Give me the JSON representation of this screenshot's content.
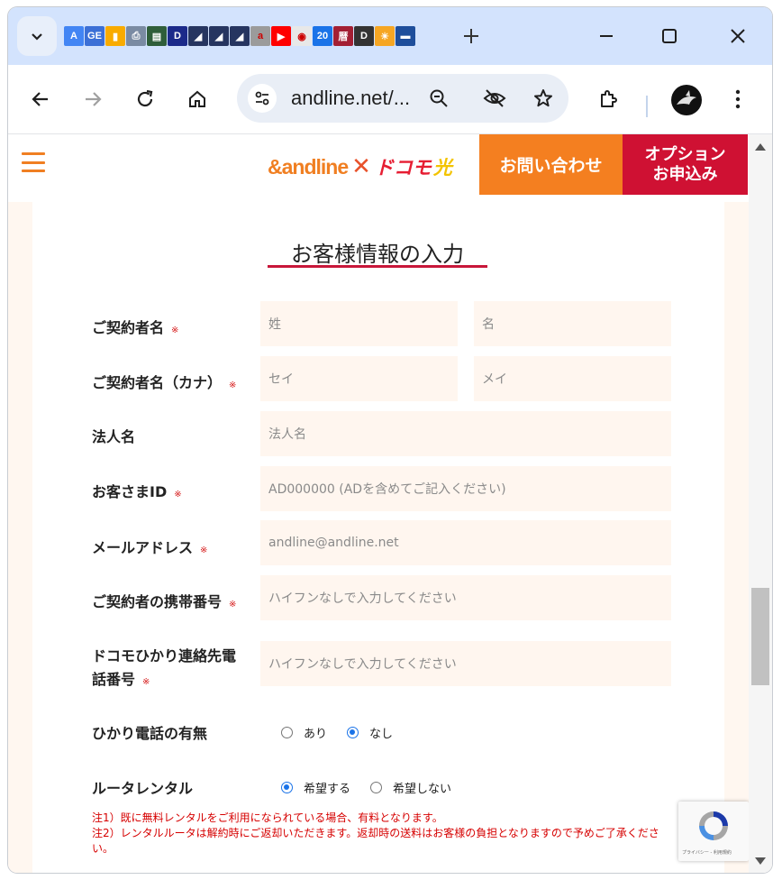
{
  "browser": {
    "url": "andline.net/...",
    "favicons": [
      {
        "name": "google-ads-icon",
        "bg": "#4285f4",
        "glyph": "A"
      },
      {
        "name": "gmail-ge-icon",
        "bg": "#3b6fd6",
        "glyph": "GE"
      },
      {
        "name": "analytics-icon",
        "bg": "#f9ab00",
        "glyph": "▮"
      },
      {
        "name": "printer-icon",
        "bg": "#7a8ba3",
        "glyph": "⎙"
      },
      {
        "name": "site-banner-icon",
        "bg": "#2f5e3a",
        "glyph": "▤"
      },
      {
        "name": "d-letter-icon",
        "bg": "#1b2a8a",
        "glyph": "D"
      },
      {
        "name": "share-bookmark-icon",
        "bg": "#263560",
        "glyph": "◢"
      },
      {
        "name": "share-bookmark-2-icon",
        "bg": "#263560",
        "glyph": "◢"
      },
      {
        "name": "share-bookmark-3-icon",
        "bg": "#263560",
        "glyph": "◢"
      },
      {
        "name": "amazon-icon",
        "bg": "#9b9b9b",
        "glyph": "a"
      },
      {
        "name": "youtube-icon",
        "bg": "#ff0000",
        "glyph": "▶"
      },
      {
        "name": "youtube-studio-icon",
        "bg": "#e8e8e8",
        "glyph": "◉"
      },
      {
        "name": "calendar-icon",
        "bg": "#1a73e8",
        "glyph": "20"
      },
      {
        "name": "reki-kanji-icon",
        "bg": "#a31f34",
        "glyph": "暦"
      },
      {
        "name": "dc-logo-icon",
        "bg": "#333333",
        "glyph": "D"
      },
      {
        "name": "sunrise-icon",
        "bg": "#f6a623",
        "glyph": "☀"
      },
      {
        "name": "landscape-icon",
        "bg": "#1e4e9b",
        "glyph": "▬"
      }
    ]
  },
  "site": {
    "logo_left": "&andline",
    "logo_cross": "✕",
    "logo_docomo": "ドコモ",
    "logo_hikari": "光",
    "contact_button": "お問い合わせ",
    "option_button_line1": "オプション",
    "option_button_line2": "お申込み"
  },
  "form": {
    "title": "お客様情報の入力",
    "required_mark": "※",
    "fields": {
      "name": {
        "label": "ご契約者名",
        "last_placeholder": "姓",
        "first_placeholder": "名"
      },
      "kana": {
        "label": "ご契約者名（カナ）",
        "last_placeholder": "セイ",
        "first_placeholder": "メイ"
      },
      "company": {
        "label": "法人名",
        "placeholder": "法人名"
      },
      "customer_id": {
        "label": "お客さまID",
        "placeholder": "AD000000 (ADを含めてご記入ください)"
      },
      "email": {
        "label": "メールアドレス",
        "placeholder": "andline@andline.net"
      },
      "mobile": {
        "label": "ご契約者の携帯番号",
        "placeholder": "ハイフンなしで入力してください"
      },
      "docomo_phone": {
        "label_line1": "ドコモひかり連絡先電",
        "label_line2": "話番号",
        "placeholder": "ハイフンなしで入力してください"
      }
    },
    "hikari_phone": {
      "label": "ひかり電話の有無",
      "option_yes": "あり",
      "option_no": "なし",
      "selected": "なし"
    },
    "router": {
      "label": "ルータレンタル",
      "option_want": "希望する",
      "option_not": "希望しない",
      "selected": "希望する"
    },
    "notes": [
      "注1）既に無料レンタルをご利用になられている場合、有料となります。",
      "注2）レンタルルータは解約時にご返却いただきます。返却時の送料はお客様の負担となりますので予めご了承ください。"
    ]
  },
  "recaptcha": {
    "footer": "プライバシー - 利用規約"
  }
}
